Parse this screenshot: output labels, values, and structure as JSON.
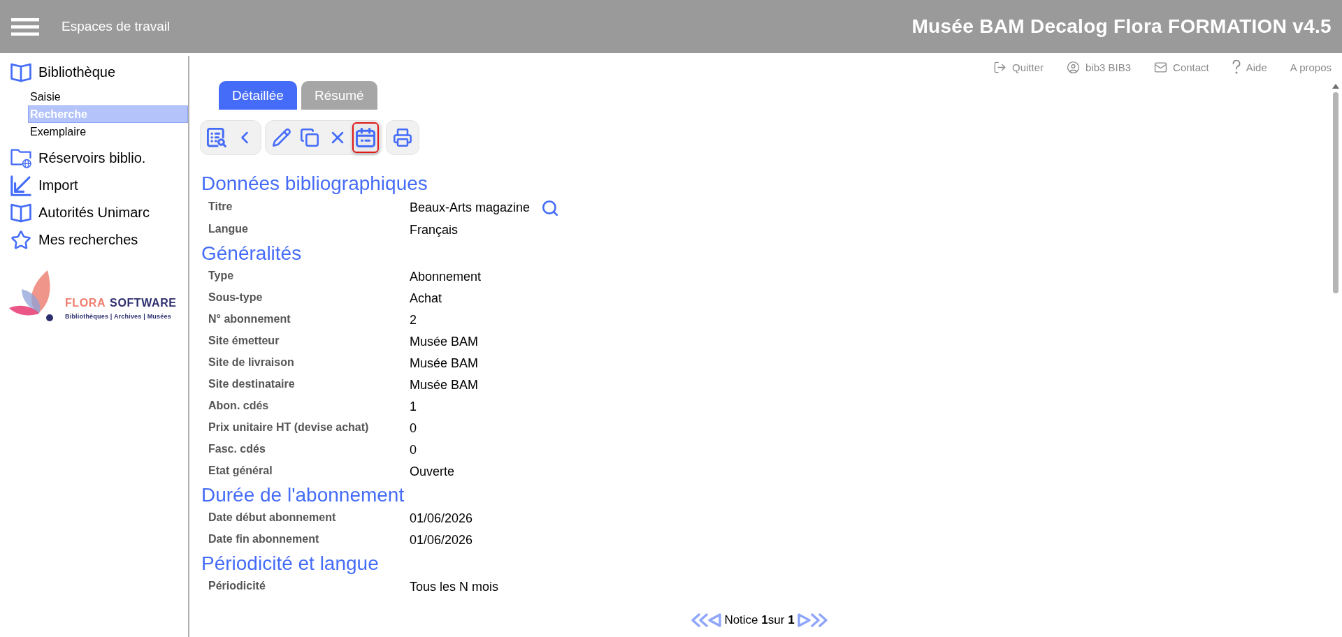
{
  "header": {
    "workspaces_label": "Espaces de travail",
    "title": "Musée BAM Decalog Flora FORMATION v4.5"
  },
  "sidebar": {
    "items": [
      {
        "label": "Bibliothèque",
        "children": [
          {
            "label": "Saisie",
            "selected": false
          },
          {
            "label": "Recherche",
            "selected": true
          },
          {
            "label": "Exemplaire",
            "selected": false
          }
        ]
      },
      {
        "label": "Réservoirs biblio."
      },
      {
        "label": "Import"
      },
      {
        "label": "Autorités Unimarc"
      },
      {
        "label": "Mes recherches"
      }
    ],
    "logo": {
      "name_first": "FLORA",
      "name_second": "SOFTWARE",
      "tagline": "Bibliothèques | Archives | Musées"
    }
  },
  "top_links": [
    {
      "label": "Quitter"
    },
    {
      "label": "bib3 BIB3"
    },
    {
      "label": "Contact"
    },
    {
      "label": "Aide"
    },
    {
      "label": "A propos"
    }
  ],
  "tabs": [
    {
      "label": "Détaillée",
      "selected": true
    },
    {
      "label": "Résumé",
      "selected": false
    }
  ],
  "toolbar": {
    "groups": [
      {
        "buttons": [
          {
            "highlighted": false
          },
          {
            "highlighted": false
          }
        ]
      },
      {
        "buttons": [
          {
            "highlighted": false
          },
          {
            "highlighted": false
          },
          {
            "highlighted": false
          },
          {
            "highlighted": true
          }
        ]
      },
      {
        "buttons": [
          {
            "highlighted": false
          }
        ]
      }
    ]
  },
  "sections": [
    {
      "title": "Données bibliographiques",
      "fields": [
        {
          "label": "Titre",
          "value": "Beaux-Arts magazine",
          "searchable": true
        },
        {
          "label": "Langue",
          "value": "Français",
          "searchable": false
        }
      ]
    },
    {
      "title": "Généralités",
      "fields": [
        {
          "label": "Type",
          "value": "Abonnement",
          "searchable": false
        },
        {
          "label": "Sous-type",
          "value": "Achat",
          "searchable": false
        },
        {
          "label": "N° abonnement",
          "value": "2",
          "searchable": false
        },
        {
          "label": "Site émetteur",
          "value": "Musée BAM",
          "searchable": false
        },
        {
          "label": "Site de livraison",
          "value": "Musée BAM",
          "searchable": false
        },
        {
          "label": "Site destinataire",
          "value": "Musée BAM",
          "searchable": false
        },
        {
          "label": "Abon. cdés",
          "value": "1",
          "searchable": false
        },
        {
          "label": "Prix unitaire HT (devise achat)",
          "value": "0",
          "searchable": false
        },
        {
          "label": "Fasc. cdés",
          "value": "0",
          "searchable": false
        },
        {
          "label": "Etat général",
          "value": "Ouverte",
          "searchable": false
        }
      ]
    },
    {
      "title": "Durée de l'abonnement",
      "fields": [
        {
          "label": "Date début abonnement",
          "value": "01/06/2026",
          "searchable": false
        },
        {
          "label": "Date fin abonnement",
          "value": "01/06/2026",
          "searchable": false
        }
      ]
    },
    {
      "title": "Périodicité et langue",
      "fields": [
        {
          "label": "Périodicité",
          "value": "Tous les N mois",
          "searchable": false
        }
      ]
    }
  ],
  "pagination": {
    "text": "Notice **1**sur **1**"
  }
}
